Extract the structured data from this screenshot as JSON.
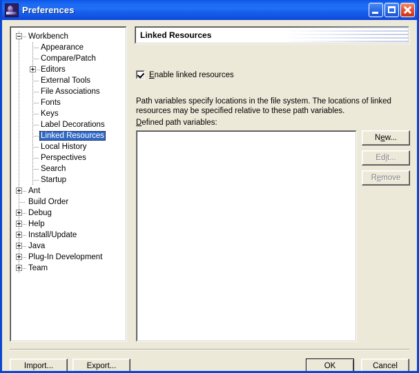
{
  "window": {
    "title": "Preferences",
    "icon": "preferences-icon",
    "controls": {
      "minimize": "minimize-button",
      "maximize": "restore-button",
      "close": "close-button"
    },
    "accent_color": "#0a46d2",
    "face_color": "#ece9d8",
    "selection_color": "#316ac5"
  },
  "tree": {
    "items": [
      {
        "label": "Workbench",
        "depth": 0,
        "toggle": "minus",
        "selected": false
      },
      {
        "label": "Appearance",
        "depth": 1,
        "toggle": "none",
        "selected": false
      },
      {
        "label": "Compare/Patch",
        "depth": 1,
        "toggle": "none",
        "selected": false
      },
      {
        "label": "Editors",
        "depth": 1,
        "toggle": "plus",
        "selected": false
      },
      {
        "label": "External Tools",
        "depth": 1,
        "toggle": "none",
        "selected": false
      },
      {
        "label": "File Associations",
        "depth": 1,
        "toggle": "none",
        "selected": false
      },
      {
        "label": "Fonts",
        "depth": 1,
        "toggle": "none",
        "selected": false
      },
      {
        "label": "Keys",
        "depth": 1,
        "toggle": "none",
        "selected": false
      },
      {
        "label": "Label Decorations",
        "depth": 1,
        "toggle": "none",
        "selected": false
      },
      {
        "label": "Linked Resources",
        "depth": 1,
        "toggle": "none",
        "selected": true
      },
      {
        "label": "Local History",
        "depth": 1,
        "toggle": "none",
        "selected": false
      },
      {
        "label": "Perspectives",
        "depth": 1,
        "toggle": "none",
        "selected": false
      },
      {
        "label": "Search",
        "depth": 1,
        "toggle": "none",
        "selected": false
      },
      {
        "label": "Startup",
        "depth": 1,
        "toggle": "none",
        "selected": false
      },
      {
        "label": "Ant",
        "depth": 0,
        "toggle": "plus",
        "selected": false
      },
      {
        "label": "Build Order",
        "depth": 0,
        "toggle": "none",
        "selected": false
      },
      {
        "label": "Debug",
        "depth": 0,
        "toggle": "plus",
        "selected": false
      },
      {
        "label": "Help",
        "depth": 0,
        "toggle": "plus",
        "selected": false
      },
      {
        "label": "Install/Update",
        "depth": 0,
        "toggle": "plus",
        "selected": false
      },
      {
        "label": "Java",
        "depth": 0,
        "toggle": "plus",
        "selected": false
      },
      {
        "label": "Plug-In Development",
        "depth": 0,
        "toggle": "plus",
        "selected": false
      },
      {
        "label": "Team",
        "depth": 0,
        "toggle": "plus",
        "selected": false
      }
    ]
  },
  "page": {
    "banner_title": "Linked Resources",
    "enable_checkbox": {
      "mnemonic": "E",
      "label_rest": "nable linked resources",
      "checked": true
    },
    "description": "Path variables specify locations in the file system. The locations of linked resources may be specified relative to these path variables.",
    "list_label_mnemonic": "D",
    "list_label_rest": "efined path variables:",
    "list_items": []
  },
  "side_buttons": [
    {
      "label": "New...",
      "mnemonic_index": 1,
      "enabled": true
    },
    {
      "label": "Edit...",
      "mnemonic_index": 2,
      "enabled": false
    },
    {
      "label": "Remove",
      "mnemonic_index": 1,
      "enabled": false
    }
  ],
  "footer": {
    "import_label": "Import...",
    "export_label": "Export...",
    "ok_label": "OK",
    "cancel_label": "Cancel"
  }
}
